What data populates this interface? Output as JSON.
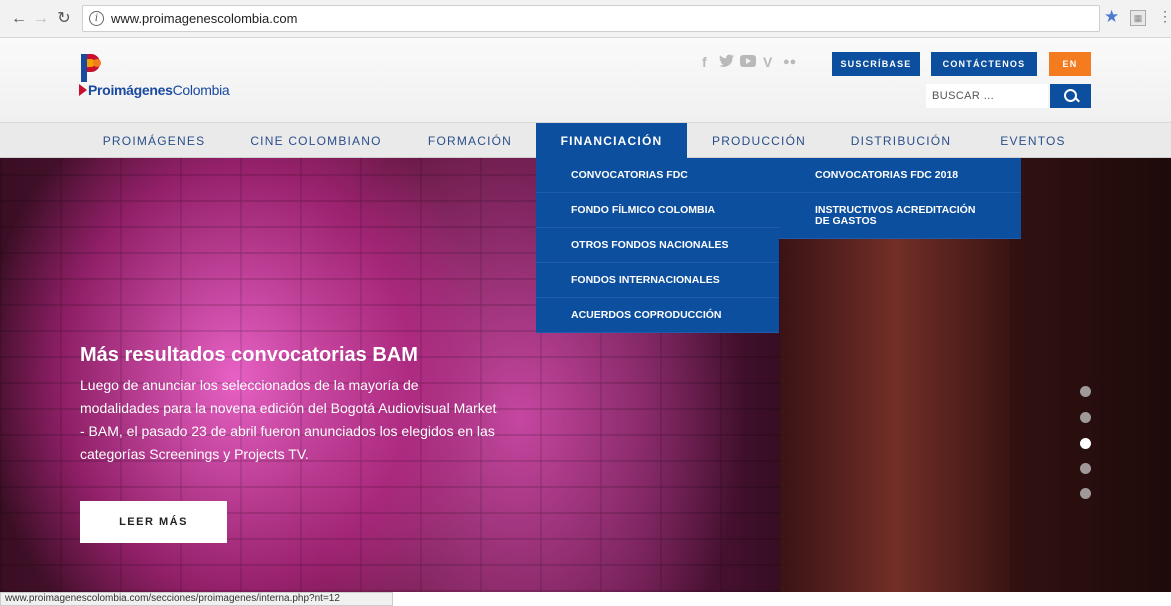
{
  "browser": {
    "url": "www.proimagenescolombia.com",
    "status_url": "www.proimagenescolombia.com/secciones/proimagenes/interna.php?nt=12"
  },
  "header": {
    "logo_bold": "Proimágenes",
    "logo_light": "Colombia",
    "social_icons": [
      "facebook-icon",
      "twitter-icon",
      "youtube-icon",
      "vimeo-icon",
      "flickr-icon"
    ],
    "suscribase_label": "SUSCRÍBASE",
    "contactenos_label": "CONTÁCTENOS",
    "lang_label": "EN",
    "search_placeholder": "BUSCAR ...",
    "colors": {
      "brand_blue": "#0d4f9f",
      "accent_orange": "#f47b20"
    }
  },
  "nav": {
    "items": [
      {
        "label": "PROIMÁGENES"
      },
      {
        "label": "CINE COLOMBIANO"
      },
      {
        "label": "FORMACIÓN"
      },
      {
        "label": "FINANCIACIÓN",
        "active": true
      },
      {
        "label": "PRODUCCIÓN"
      },
      {
        "label": "DISTRIBUCIÓN"
      },
      {
        "label": "EVENTOS"
      }
    ]
  },
  "dropdown": {
    "items": [
      {
        "label": "CONVOCATORIAS FDC"
      },
      {
        "label": "FONDO FÍLMICO COLOMBIA"
      },
      {
        "label": "OTROS FONDOS NACIONALES"
      },
      {
        "label": "FONDOS INTERNACIONALES"
      },
      {
        "label": "ACUERDOS COPRODUCCIÓN"
      }
    ],
    "submenu": [
      {
        "label": "CONVOCATORIAS FDC 2018"
      },
      {
        "label": "INSTRUCTIVOS ACREDITACIÓN DE GASTOS"
      }
    ]
  },
  "hero": {
    "title": "Más resultados convocatorias BAM",
    "description": "Luego de anunciar los seleccionados de la mayoría de modalidades para la novena edición del Bogotá Audiovisual Market - BAM, el pasado 23 de abril fueron anunciados los elegidos en las categorías Screenings y Projects TV.",
    "button_label": "LEER MÁS",
    "slides_total": 5,
    "active_slide": 3
  }
}
